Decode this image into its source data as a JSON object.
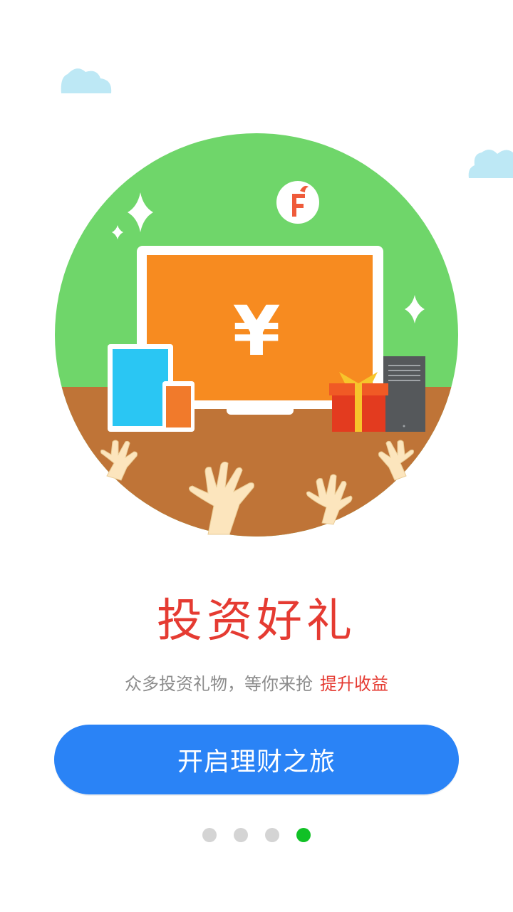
{
  "intro": {
    "title": "投资好礼",
    "subtitle_main": "众多投资礼物，等你来抢",
    "subtitle_highlight": "提升收益",
    "cta_label": "开启理财之旅",
    "currency_symbol": "¥",
    "badge_letter": "F"
  },
  "pager": {
    "total": 4,
    "active_index": 3
  },
  "colors": {
    "accent_red": "#e53b32",
    "button_blue": "#2a83f6",
    "active_dot": "#11c126",
    "inactive_dot": "#d4d4d4"
  },
  "icons": [
    "cloud-icon",
    "sparkle-icon",
    "brand-badge-icon",
    "monitor-icon",
    "tablet-icon",
    "phone-icon",
    "gift-icon",
    "server-icon",
    "hand-icon"
  ]
}
